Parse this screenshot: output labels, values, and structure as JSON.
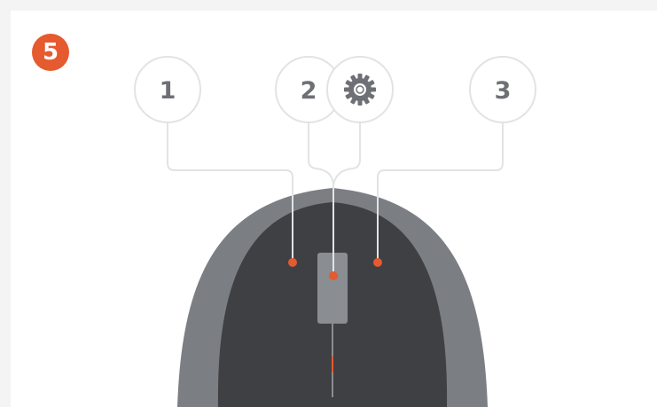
{
  "step": {
    "number": "5"
  },
  "buttons": [
    {
      "label": "1"
    },
    {
      "label": "2"
    },
    {
      "label": "3"
    }
  ],
  "icons": {
    "wheel": "gear-icon"
  },
  "colors": {
    "accent": "#e55a2e",
    "mouse_outer": "#7b7e83",
    "mouse_inner": "#3f4043",
    "scroll_wheel": "#8a8d92",
    "callout_line": "#e2e3e5",
    "label_text": "#6e7075"
  }
}
